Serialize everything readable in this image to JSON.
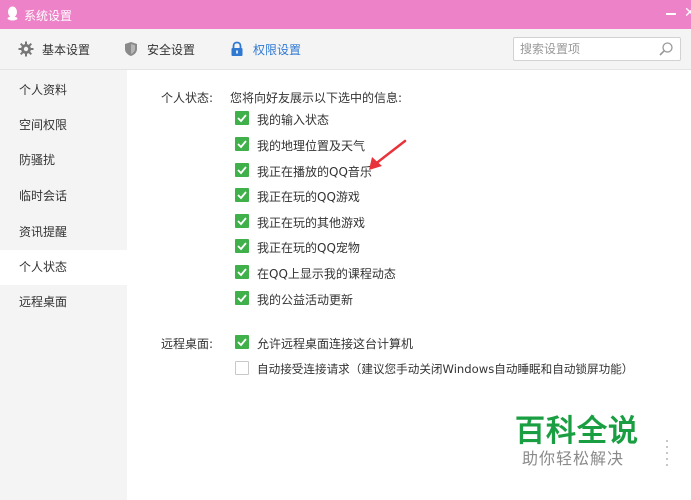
{
  "window": {
    "title": "系统设置",
    "minimize_glyph": "—",
    "close_glyph": "✕"
  },
  "toolbar": {
    "tabs": [
      {
        "label": "基本设置",
        "icon": "gear-icon"
      },
      {
        "label": "安全设置",
        "icon": "shield-icon"
      },
      {
        "label": "权限设置",
        "icon": "lock-icon",
        "active": true
      }
    ],
    "search_placeholder": "搜索设置项"
  },
  "sidebar": {
    "items": [
      {
        "label": "个人资料"
      },
      {
        "label": "空间权限"
      },
      {
        "label": "防骚扰"
      },
      {
        "label": "临时会话"
      },
      {
        "label": "资讯提醒"
      },
      {
        "label": "个人状态",
        "active": true
      },
      {
        "label": "远程桌面"
      }
    ]
  },
  "personal_status": {
    "label": "个人状态:",
    "intro": "您将向好友展示以下选中的信息:",
    "options": [
      {
        "label": "我的输入状态",
        "checked": true
      },
      {
        "label": "我的地理位置及天气",
        "checked": true
      },
      {
        "label": "我正在播放的QQ音乐",
        "checked": true
      },
      {
        "label": "我正在玩的QQ游戏",
        "checked": true
      },
      {
        "label": "我正在玩的其他游戏",
        "checked": true
      },
      {
        "label": "我正在玩的QQ宠物",
        "checked": true
      },
      {
        "label": "在QQ上显示我的课程动态",
        "checked": true
      },
      {
        "label": "我的公益活动更新",
        "checked": true
      }
    ]
  },
  "remote_desktop": {
    "label": "远程桌面:",
    "options": [
      {
        "label": "允许远程桌面连接这台计算机",
        "checked": true
      },
      {
        "label": "自动接受连接请求（建议您手动关闭Windows自动睡眠和自动锁屏功能）",
        "checked": false
      }
    ]
  },
  "watermark": {
    "title": "百科全说",
    "subtitle": "助你轻松解决"
  },
  "colors": {
    "titlebar": "#ee82c8",
    "accent": "#2f79d3",
    "checkbox_checked": "#3fb04a",
    "annotation_arrow": "#e8333a",
    "watermark_green": "#1a9e42"
  }
}
